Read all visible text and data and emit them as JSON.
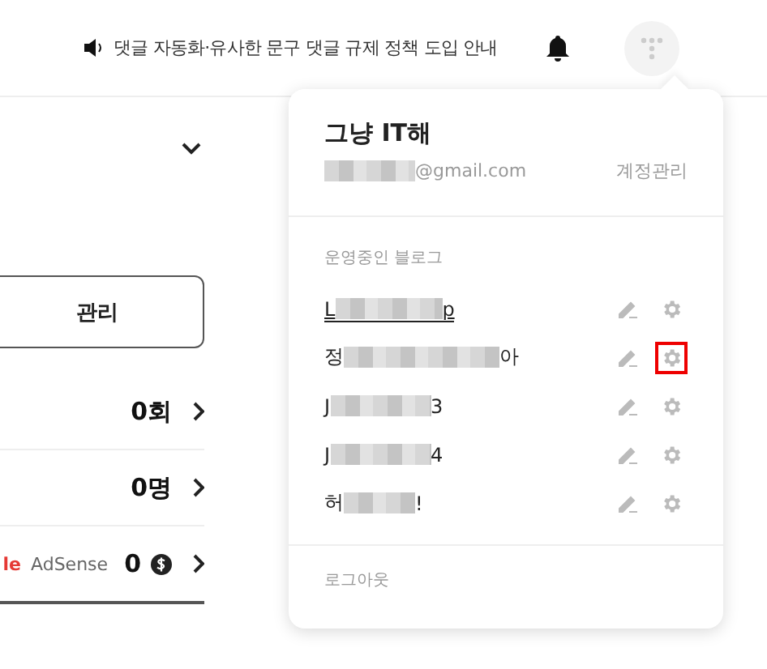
{
  "notice": {
    "text": "댓글 자동화·유사한 문구 댓글 규제 정책 도입 안내"
  },
  "left_panel": {
    "manage_button": "관리",
    "stats": [
      {
        "kind": "count",
        "value": "0회"
      },
      {
        "kind": "count",
        "value": "0명"
      },
      {
        "kind": "adsense",
        "brand_fragment": "le",
        "product": "AdSense",
        "value": "0"
      }
    ]
  },
  "account_menu": {
    "name": "그냥 IT해",
    "email": "@gmail.com",
    "manage_link": "계정관리",
    "section_title": "운영중인 블로그",
    "blogs": [
      {
        "start": "L",
        "end": "p",
        "hovered": true,
        "settings_highlighted": false
      },
      {
        "start": "정",
        "end": "아",
        "hovered": false,
        "settings_highlighted": true
      },
      {
        "start": "J",
        "end": "3",
        "hovered": false,
        "settings_highlighted": false
      },
      {
        "start": "J",
        "end": "4",
        "hovered": false,
        "settings_highlighted": false
      },
      {
        "start": "허",
        "end": "!",
        "hovered": false,
        "settings_highlighted": false
      }
    ],
    "logout": "로그아웃"
  }
}
